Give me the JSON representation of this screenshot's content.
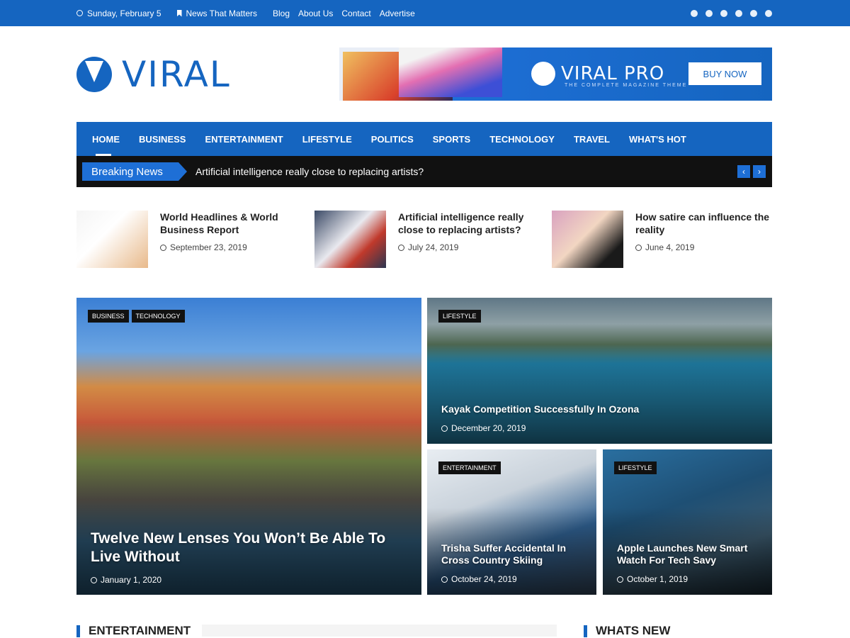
{
  "topbar": {
    "date": "Sunday, February 5",
    "tagline": "News That Matters",
    "links": [
      "Blog",
      "About Us",
      "Contact",
      "Advertise"
    ],
    "social_icons": [
      "facebook-icon",
      "twitter-icon",
      "pinterest-icon",
      "youtube-icon",
      "linkedin-icon",
      "instagram-icon"
    ]
  },
  "header": {
    "logo_text": "VIRAL",
    "ad": {
      "brand": "VIRAL PRO",
      "tagline": "THE COMPLETE MAGAZINE THEME",
      "button": "BUY NOW"
    }
  },
  "nav": {
    "items": [
      "HOME",
      "BUSINESS",
      "ENTERTAINMENT",
      "LIFESTYLE",
      "POLITICS",
      "SPORTS",
      "TECHNOLOGY",
      "TRAVEL",
      "WHAT'S HOT"
    ],
    "active_index": 0
  },
  "breaking": {
    "label": "Breaking News",
    "headline": "Artificial intelligence really close to replacing artists?"
  },
  "small_posts": [
    {
      "title": "World Headlines & World Business Report",
      "date": "September 23, 2019"
    },
    {
      "title": "Artificial intelligence really close to replacing artists?",
      "date": "July 24, 2019"
    },
    {
      "title": "How satire can influence the reality",
      "date": "June 4, 2019"
    }
  ],
  "featured": {
    "big": {
      "tags": [
        "BUSINESS",
        "TECHNOLOGY"
      ],
      "title": "Twelve New Lenses You Won’t Be Able To Live Without",
      "date": "January 1, 2020"
    },
    "kayak": {
      "tags": [
        "LIFESTYLE"
      ],
      "title": "Kayak Competition Successfully In Ozona",
      "date": "December 20, 2019"
    },
    "ski": {
      "tags": [
        "ENTERTAINMENT"
      ],
      "title": "Trisha Suffer Accidental In Cross Country Skiing",
      "date": "October 24, 2019"
    },
    "watch": {
      "tags": [
        "LIFESTYLE"
      ],
      "title": "Apple Launches New Smart Watch For Tech Savy",
      "date": "October 1, 2019"
    }
  },
  "sections": {
    "left": "ENTERTAINMENT",
    "right": "WHATS NEW"
  },
  "colors": {
    "brand": "#1565c0",
    "breaking_bg": "#111111",
    "tag_bg": "#111111"
  }
}
